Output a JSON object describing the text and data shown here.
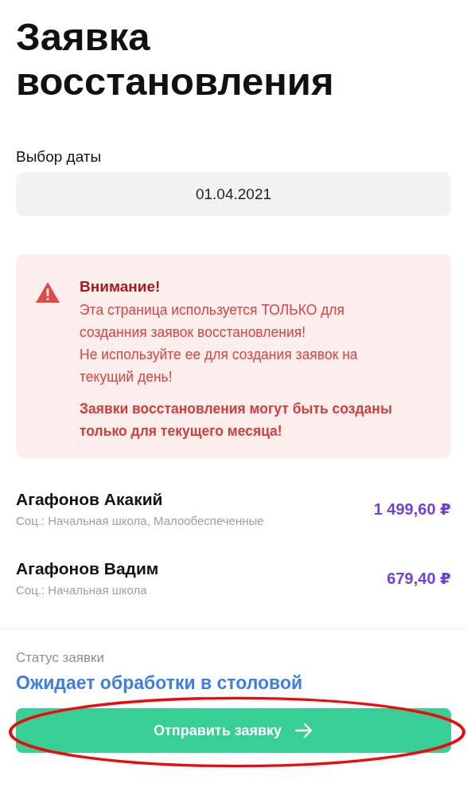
{
  "title": "Заявка восстановления",
  "date_picker": {
    "label": "Выбор даты",
    "value": "01.04.2021"
  },
  "alert": {
    "title": "Внимание!",
    "messages": [
      {
        "text": "Эта страница используется ТОЛЬКО для созданния заявок восстановления!",
        "emphasized": false
      },
      {
        "text": "Не используйте ее для создания заявок на текущий день!",
        "emphasized": false
      },
      {
        "text": "Заявки восстановления могут быть созданы только для текущего месяца!",
        "emphasized": true
      }
    ]
  },
  "students": [
    {
      "name": "Агафонов Акакий",
      "category": "Соц.: Начальная школа, Малообеспеченные",
      "amount": "1 499,60 ₽"
    },
    {
      "name": "Агафонов Вадим",
      "category": "Соц.: Начальная школа",
      "amount": "679,40 ₽"
    }
  ],
  "status": {
    "label": "Статус заявки",
    "value": "Ожидает обработки в столовой"
  },
  "submit_button": {
    "label": "Отправить заявку"
  }
}
